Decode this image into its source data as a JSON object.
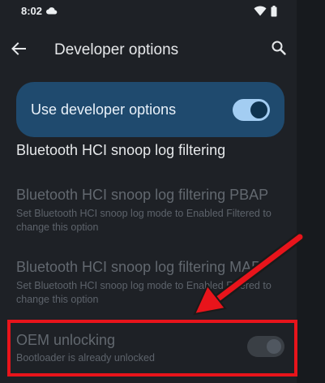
{
  "status": {
    "time": "8:02",
    "icons": [
      "cloud-icon",
      "wifi-icon",
      "battery-icon"
    ]
  },
  "appbar": {
    "title": "Developer options",
    "icons": [
      "back-arrow-icon",
      "search-icon"
    ]
  },
  "master_switch": {
    "label": "Use developer options",
    "state": "on"
  },
  "settings": [
    {
      "title": "Bluetooth HCI snoop log filtering",
      "subtitle": "",
      "enabled": true
    },
    {
      "title": "Bluetooth HCI snoop log filtering PBAP",
      "subtitle": "Set Bluetooth HCI snoop log mode to Enabled Filtered to change this option",
      "enabled": false
    },
    {
      "title": "Bluetooth HCI snoop log filtering MAP",
      "subtitle": "Set Bluetooth HCI snoop log mode to Enabled Filtered to change this option",
      "enabled": false
    },
    {
      "title": "OEM unlocking",
      "subtitle": "Bootloader is already unlocked",
      "enabled": false,
      "toggle_state": "off"
    }
  ],
  "colors": {
    "accent": "#a3cdf2",
    "master_bg": "#1f4a6e",
    "annotation": "#e8141b"
  }
}
